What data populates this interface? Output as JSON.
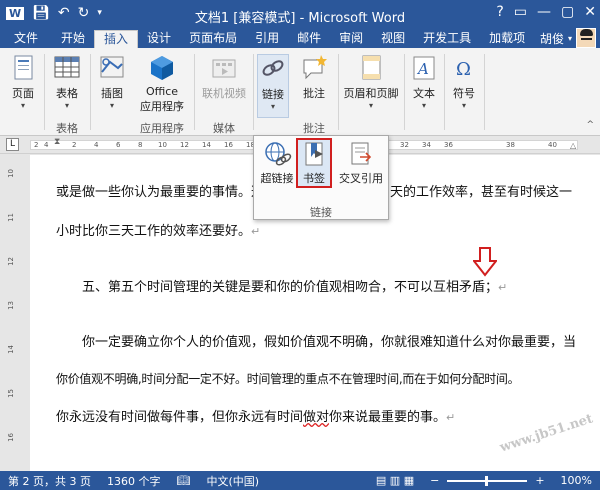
{
  "window": {
    "title": "文档1 [兼容模式] - Microsoft Word",
    "controls": [
      "?",
      "▭",
      "—",
      "▢",
      "✕"
    ]
  },
  "qat": {
    "icons": [
      "save-icon",
      "undo-icon",
      "redo-icon"
    ]
  },
  "tabs": [
    {
      "label": "文件"
    },
    {
      "label": "开始"
    },
    {
      "label": "插入"
    },
    {
      "label": "设计"
    },
    {
      "label": "页面布局"
    },
    {
      "label": "引用"
    },
    {
      "label": "邮件"
    },
    {
      "label": "审阅"
    },
    {
      "label": "视图"
    },
    {
      "label": "开发工具"
    },
    {
      "label": "加载项"
    }
  ],
  "active_tab": "插入",
  "user": {
    "name": "胡俊"
  },
  "ribbon": {
    "buttons": {
      "pages": "页面",
      "table": "表格",
      "illustrations": "插图",
      "office_apps_1": "Office",
      "office_apps_2": "应用程序",
      "online_video": "联机视频",
      "links": "链接",
      "comment": "批注",
      "header_footer": "页眉和页脚",
      "text": "文本",
      "symbol": "符号"
    },
    "groups": {
      "tables": "表格",
      "apps": "应用程序",
      "media": "媒体",
      "comments": "批注"
    }
  },
  "links_dropdown": {
    "hyperlink": "超链接",
    "bookmark": "书签",
    "cross_reference": "交叉引用",
    "group_label": "链接"
  },
  "ruler": {
    "ind": "L",
    "nums": [
      "2",
      "4",
      "2",
      "4",
      "6",
      "8",
      "10",
      "12",
      "14",
      "16",
      "18",
      "20",
      "22",
      "24",
      "26",
      "28",
      "30",
      "32",
      "34",
      "36",
      "38",
      "40"
    ]
  },
  "vruler": {
    "nums": [
      "10",
      "11",
      "12",
      "13",
      "14",
      "15",
      "16"
    ]
  },
  "document": {
    "line1a": "或是做一些你认为最重要的事情。这",
    "line1b": "天的工作效率，甚至有时候这一",
    "line2": "小时比你三天工作的效率还要好。",
    "line3": "五、第五个时间管理的关键是要和你的价值观相吻合，不可以互相矛盾；",
    "line4": "你一定要确立你个人的价值观，假如价值观不明确，你就很难知道什么对你最重要，当",
    "line5": "你价值观不明确,时间分配一定不好。时间管理的重点不在管理时间,而在于如何分配时间。",
    "line6a": "你永远没有时间做每件事，但你永远有时间",
    "line6b": "做对",
    "line6c": "你来说最重要的事。",
    "para_mark": "↵"
  },
  "status": {
    "page": "第 2 页，共 3 页",
    "words": "1360 个字",
    "language": "中文(中国)",
    "zoom": "100%",
    "zoom_minus": "−",
    "zoom_plus": "+"
  },
  "watermark": "www.jb51.net",
  "colors": {
    "accent": "#2b579a",
    "highlight_border": "#d11f1f",
    "arrow": "#d11f1f"
  }
}
